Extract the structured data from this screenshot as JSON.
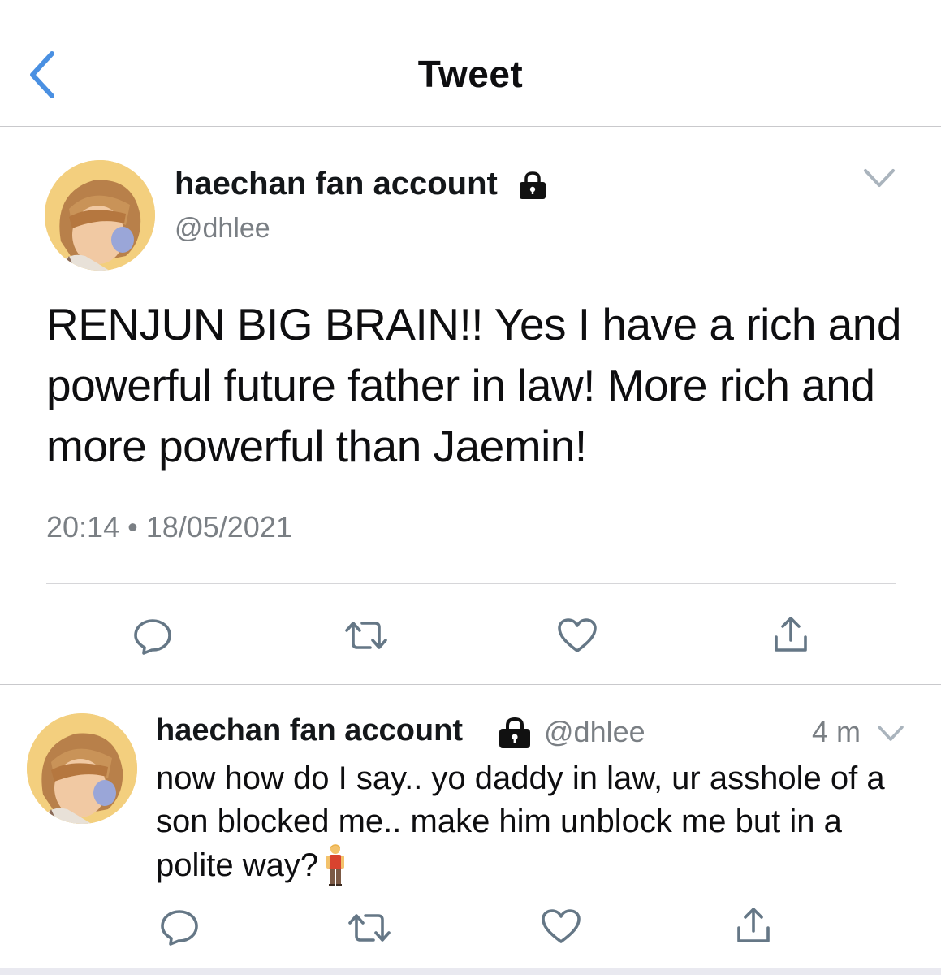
{
  "header": {
    "title": "Tweet",
    "back_icon": "chevron-left-icon"
  },
  "colors": {
    "accent": "#4a90e2",
    "secondary_text": "#7a7f84",
    "icon_gray": "#657786"
  },
  "main_tweet": {
    "display_name": "haechan fan account",
    "handle": "@dhlee",
    "text": "RENJUN BIG BRAIN!! Yes I have a rich and powerful future father in law! More rich and more powerful than Jaemin!",
    "timestamp": "20:14 • 18/05/2021",
    "actions": [
      "reply-icon",
      "retweet-icon",
      "like-icon",
      "share-icon"
    ]
  },
  "reply_tweet": {
    "display_name": "haechan fan account",
    "handle": "@dhlee",
    "time_ago": "4 m",
    "text": "now how do I say.. yo daddy in law, ur asshole of a son blocked me.. make him unblock me but in a polite way?",
    "emoji": "person-standing-emoji",
    "actions": [
      "reply-icon",
      "retweet-icon",
      "like-icon",
      "share-icon"
    ]
  }
}
